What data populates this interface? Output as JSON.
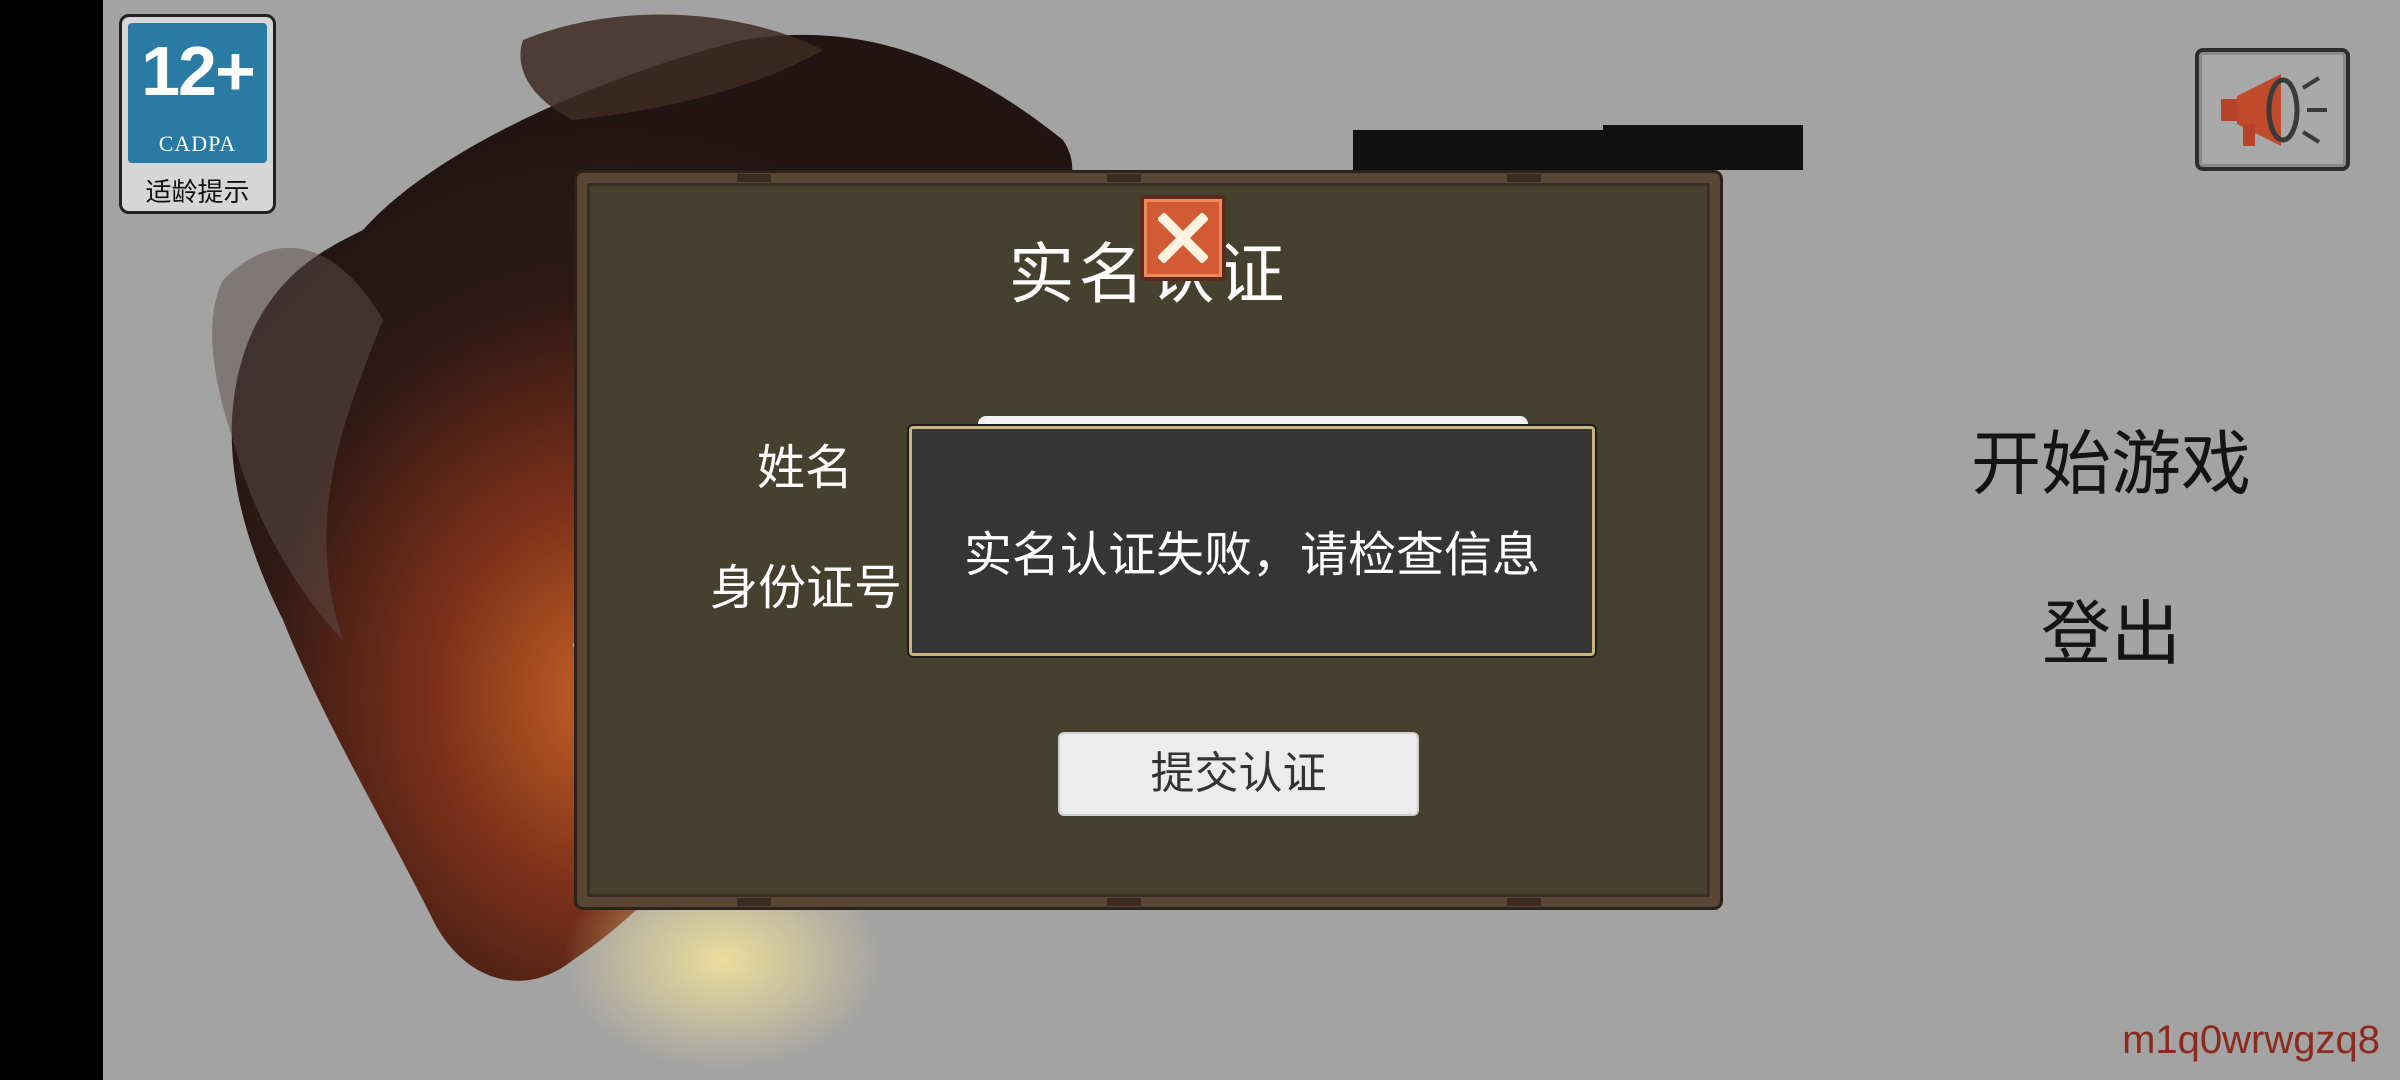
{
  "age_badge": {
    "rating": "12+",
    "org": "CADPA",
    "tip": "适龄提示"
  },
  "announce_button": {
    "icon": "megaphone-icon"
  },
  "menu": {
    "start_game": "开始游戏",
    "logout": "登出"
  },
  "user_id": "m1q0wrwgzq8",
  "dialog": {
    "title": "实名认证",
    "name_label": "姓名",
    "id_label": "身份证号",
    "name_value": "",
    "id_value": "",
    "submit_label": "提交认证",
    "close_icon": "close-icon"
  },
  "toast": {
    "message": "实名认证失败，请检查信息"
  },
  "colors": {
    "background": "#a3a3a3",
    "dialog_bg": "#46402f",
    "close_button": "#d25a34",
    "user_id_text": "#8b2a1e"
  }
}
